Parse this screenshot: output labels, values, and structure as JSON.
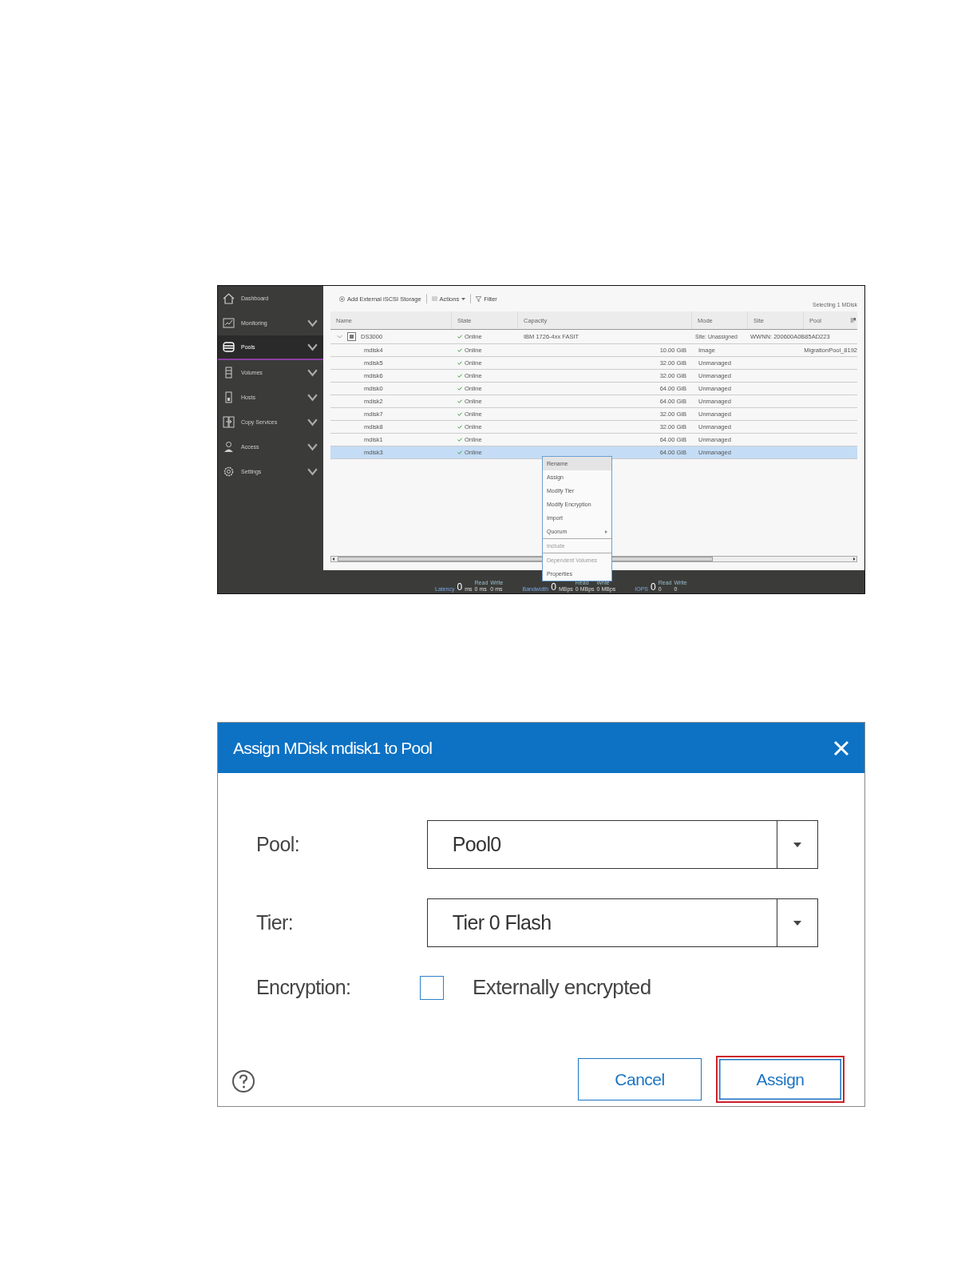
{
  "screenshot": {
    "sidebar": {
      "items": [
        {
          "label": "Dashboard",
          "selected": false,
          "has_submenu": false
        },
        {
          "label": "Monitoring",
          "selected": false,
          "has_submenu": true
        },
        {
          "label": "Pools",
          "selected": true,
          "has_submenu": true
        },
        {
          "label": "Volumes",
          "selected": false,
          "has_submenu": true
        },
        {
          "label": "Hosts",
          "selected": false,
          "has_submenu": true
        },
        {
          "label": "Copy Services",
          "selected": false,
          "has_submenu": true
        },
        {
          "label": "Access",
          "selected": false,
          "has_submenu": true
        },
        {
          "label": "Settings",
          "selected": false,
          "has_submenu": true
        }
      ]
    },
    "toolbar": {
      "add_button": "Add External iSCSI Storage",
      "actions_button": "Actions",
      "filter_button": "Filter",
      "selection_info": "Selecting 1 MDisk"
    },
    "table": {
      "columns": [
        "Name",
        "State",
        "Capacity",
        "Mode",
        "Site",
        "Pool"
      ],
      "rows": [
        {
          "kind": "group",
          "name": "DS3000",
          "expanded": true,
          "state": "Online",
          "capacity": "IBM 1726-4xx FASIT",
          "mode": "Site: Unassigned",
          "site": "WWNN: 200600A0B85AD223",
          "selected": false
        },
        {
          "kind": "mdisk",
          "name": "mdisk4",
          "state": "Online",
          "capacity": "10.00 GiB",
          "mode": "Image",
          "pool": "MigrationPool_8192",
          "selected": false
        },
        {
          "kind": "mdisk",
          "name": "mdisk5",
          "state": "Online",
          "capacity": "32.00 GiB",
          "mode": "Unmanaged",
          "selected": false
        },
        {
          "kind": "mdisk",
          "name": "mdisk6",
          "state": "Online",
          "capacity": "32.00 GiB",
          "mode": "Unmanaged",
          "selected": false
        },
        {
          "kind": "mdisk",
          "name": "mdisk0",
          "state": "Online",
          "capacity": "64.00 GiB",
          "mode": "Unmanaged",
          "selected": false
        },
        {
          "kind": "mdisk",
          "name": "mdisk2",
          "state": "Online",
          "capacity": "64.00 GiB",
          "mode": "Unmanaged",
          "selected": false
        },
        {
          "kind": "mdisk",
          "name": "mdisk7",
          "state": "Online",
          "capacity": "32.00 GiB",
          "mode": "Unmanaged",
          "selected": false
        },
        {
          "kind": "mdisk",
          "name": "mdisk8",
          "state": "Online",
          "capacity": "32.00 GiB",
          "mode": "Unmanaged",
          "selected": false
        },
        {
          "kind": "mdisk",
          "name": "mdisk1",
          "state": "Online",
          "capacity": "64.00 GiB",
          "mode": "Unmanaged",
          "selected": false
        },
        {
          "kind": "mdisk",
          "name": "mdisk3",
          "state": "Online",
          "capacity": "64.00 GiB",
          "mode": "Unmanaged",
          "selected": true
        }
      ]
    },
    "context_menu": {
      "items": [
        {
          "label": "Rename",
          "hovered": true,
          "disabled": false,
          "submenu": false,
          "separator_before": false
        },
        {
          "label": "Assign",
          "hovered": false,
          "disabled": false,
          "submenu": false,
          "separator_before": false
        },
        {
          "label": "Modify Tier",
          "hovered": false,
          "disabled": false,
          "submenu": false,
          "separator_before": false
        },
        {
          "label": "Modify Encryption",
          "hovered": false,
          "disabled": false,
          "submenu": false,
          "separator_before": false
        },
        {
          "label": "Import",
          "hovered": false,
          "disabled": false,
          "submenu": false,
          "separator_before": false
        },
        {
          "label": "Quorum",
          "hovered": false,
          "disabled": false,
          "submenu": true,
          "separator_before": false
        },
        {
          "label": "Include",
          "hovered": false,
          "disabled": true,
          "submenu": false,
          "separator_before": true
        },
        {
          "label": "Dependent Volumes",
          "hovered": false,
          "disabled": true,
          "submenu": false,
          "separator_before": true
        },
        {
          "label": "Properties",
          "hovered": false,
          "disabled": false,
          "submenu": false,
          "separator_before": false
        }
      ]
    },
    "status_bar": {
      "metrics": [
        {
          "label": "Latency",
          "value": "0",
          "unit": "ms",
          "read_label": "Read",
          "read": "0 ms",
          "write_label": "Write",
          "write": "0 ms"
        },
        {
          "label": "Bandwidth",
          "value": "0",
          "unit": "MBps",
          "read_label": "Read",
          "read": "0 MBps",
          "write_label": "Write",
          "write": "0 MBps"
        },
        {
          "label": "IOPS",
          "value": "0",
          "read_label": "Read",
          "read": "0",
          "write_label": "Write",
          "write": "0"
        }
      ]
    }
  },
  "dialog": {
    "title": "Assign MDisk mdisk1 to Pool",
    "fields": [
      {
        "kind": "select",
        "label": "Pool:",
        "value": "Pool0"
      },
      {
        "kind": "select",
        "label": "Tier:",
        "value": "Tier 0 Flash"
      },
      {
        "kind": "checkbox",
        "label": "Encryption:",
        "option": "Externally encrypted",
        "checked": false
      }
    ],
    "buttons": [
      {
        "label": "Cancel",
        "highlighted": false
      },
      {
        "label": "Assign",
        "highlighted": true
      }
    ]
  }
}
